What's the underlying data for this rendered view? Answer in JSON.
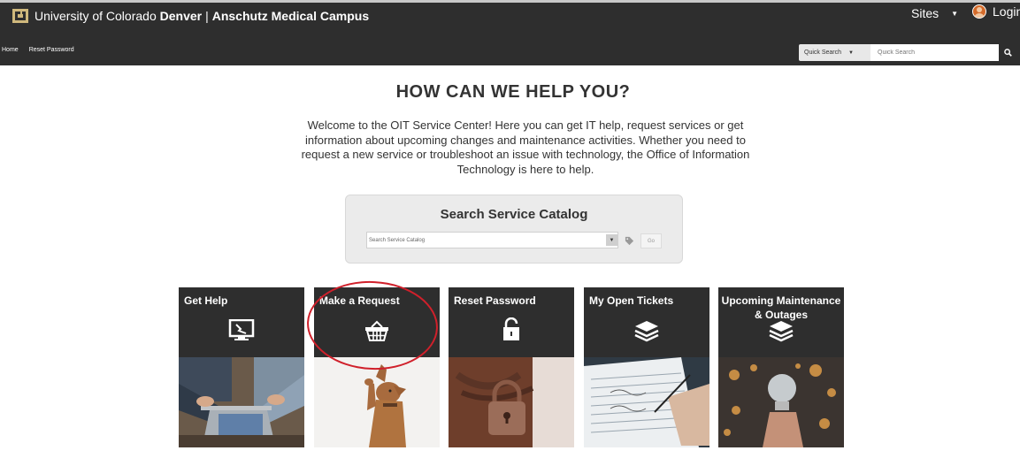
{
  "header": {
    "brand_prefix": "University of Colorado",
    "brand_bold1": "Denver",
    "brand_sep": "|",
    "brand_bold2": "Anschutz Medical Campus",
    "sites_label": "Sites",
    "login_label": "Login",
    "logo_icon": "cu-logo-icon"
  },
  "nav": {
    "items": [
      {
        "label": "Home"
      },
      {
        "label": "Reset Password"
      }
    ]
  },
  "quick_search": {
    "select_label": "Quick Search",
    "placeholder": "Quick Search",
    "button_icon": "search-icon"
  },
  "main": {
    "title": "HOW CAN WE HELP YOU?",
    "intro": "Welcome to the OIT Service Center! Here you can get IT help, request services or get information about upcoming changes and maintenance activities. Whether you need to request a new service or troubleshoot an issue with technology, the Office of Information Technology is here to help."
  },
  "catalog": {
    "title": "Search Service Catalog",
    "placeholder": "Search Service Catalog",
    "go_label": "Go",
    "tag_icon": "tag-icon"
  },
  "tiles": [
    {
      "label": "Get Help",
      "icon": "monitor-broken-icon"
    },
    {
      "label": "Make a Request",
      "icon": "basket-icon"
    },
    {
      "label": "Reset Password",
      "icon": "lock-icon"
    },
    {
      "label": "My Open Tickets",
      "icon": "stack-icon"
    },
    {
      "label": "Upcoming Maintenance & Outages",
      "icon": "stack-icon"
    }
  ],
  "colors": {
    "header_bg": "#2e2e2e",
    "tile_bg": "#2e2e2e",
    "annotation": "#d0202b",
    "page_bg": "#ffffff"
  }
}
